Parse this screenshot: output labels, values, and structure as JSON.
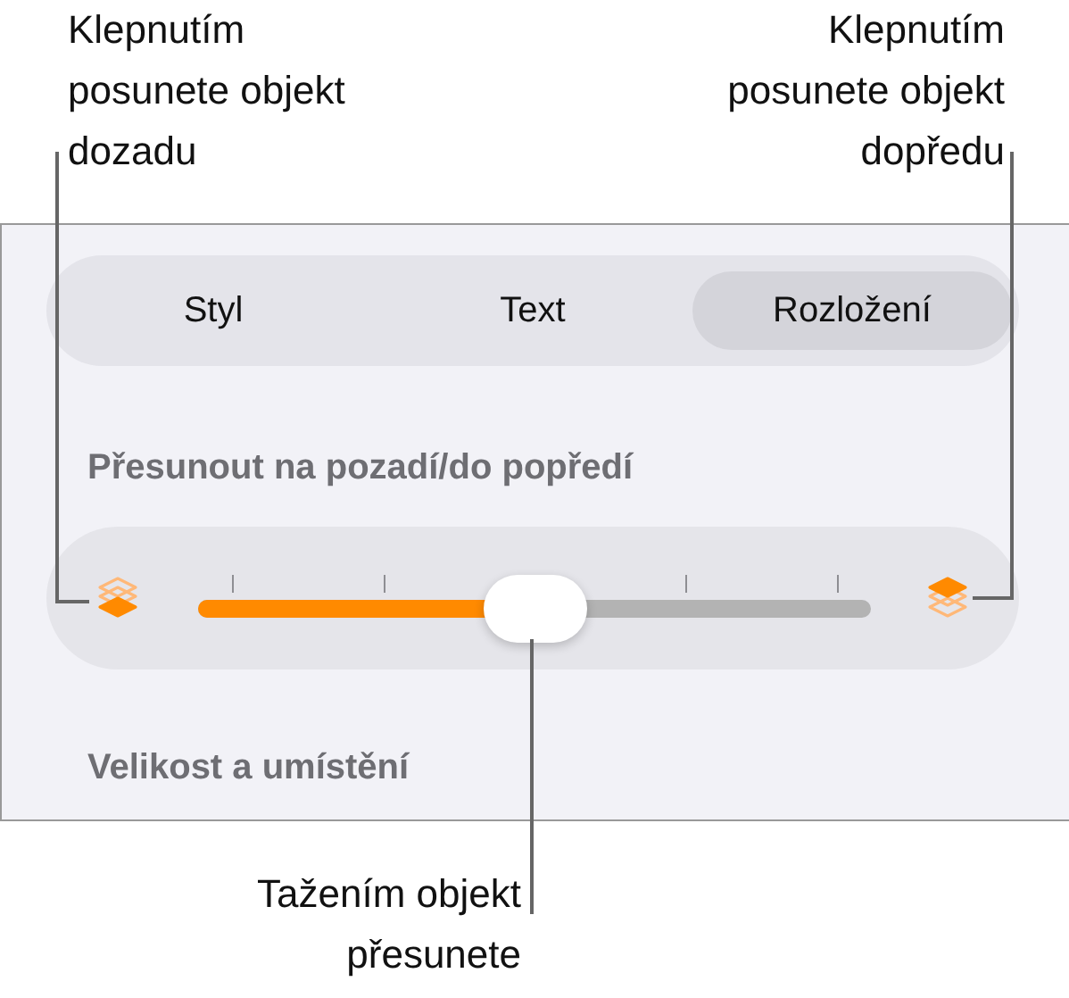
{
  "callouts": [
    {
      "text": "Klepnutím\nposunete objekt\ndozadu"
    },
    {
      "text": "Klepnutím\nposunete objekt\ndopředu"
    }
  ],
  "tabs": [
    {
      "label": "Styl",
      "selected": false
    },
    {
      "label": "Text",
      "selected": false
    },
    {
      "label": "Rozložení",
      "selected": true
    }
  ],
  "arrange_title": "Přesunout na pozadí/do popředí",
  "slider": {
    "level": 0.5
  },
  "size_title": "Velikost a umístění",
  "bottom_callout": "Tažením objekt\npřesunete"
}
